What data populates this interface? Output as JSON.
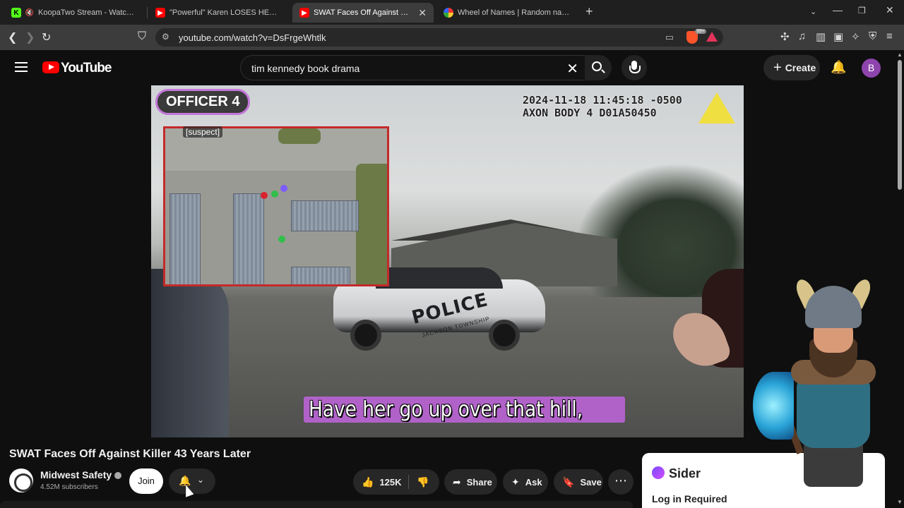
{
  "browser": {
    "tabs": [
      {
        "title": "KoopaTwo Stream - Watch Live o",
        "favicon": "K",
        "favicon_color": "#53fc18"
      },
      {
        "title": "\"Powerful\" Karen LOSES HER MIND V",
        "favicon": "▶",
        "favicon_color": "#ff0000"
      },
      {
        "title": "SWAT Faces Off Against Killer",
        "favicon": "▶",
        "favicon_color": "#ff0000",
        "active": true
      },
      {
        "title": "Wheel of Names | Random name pic",
        "favicon": "◐",
        "favicon_color": "#4f9cf7"
      }
    ],
    "url": "youtube.com/watch?v=DsFrgeWhtlk",
    "brave_badge": "99+"
  },
  "youtube": {
    "logo_text": "YouTube",
    "search_query": "tim kennedy book drama",
    "create_label": "Create",
    "avatar_letter": "B"
  },
  "video": {
    "officer_badge": "OFFICER 4",
    "timestamp_line1": "2024-11-18 11:45:18 -0500",
    "timestamp_line2": "AXON BODY 4 D01A50450",
    "map_label": "[suspect]",
    "car_text": "POLICE",
    "car_subtext": "JACKSON TOWNSHIP",
    "caption": "Have her go up over that hill,"
  },
  "below": {
    "title": "SWAT Faces Off Against Killer 43 Years Later",
    "channel_name": "Midwest Safety",
    "subscribers": "4.52M subscribers",
    "join_label": "Join",
    "likes": "125K",
    "share_label": "Share",
    "ask_label": "Ask",
    "save_label": "Save"
  },
  "sider": {
    "name": "Sider",
    "login": "Log in Required"
  },
  "colors": {
    "accent": "#ff0000",
    "caption_bg": "#b062c8",
    "map_border": "#c42a2a"
  }
}
